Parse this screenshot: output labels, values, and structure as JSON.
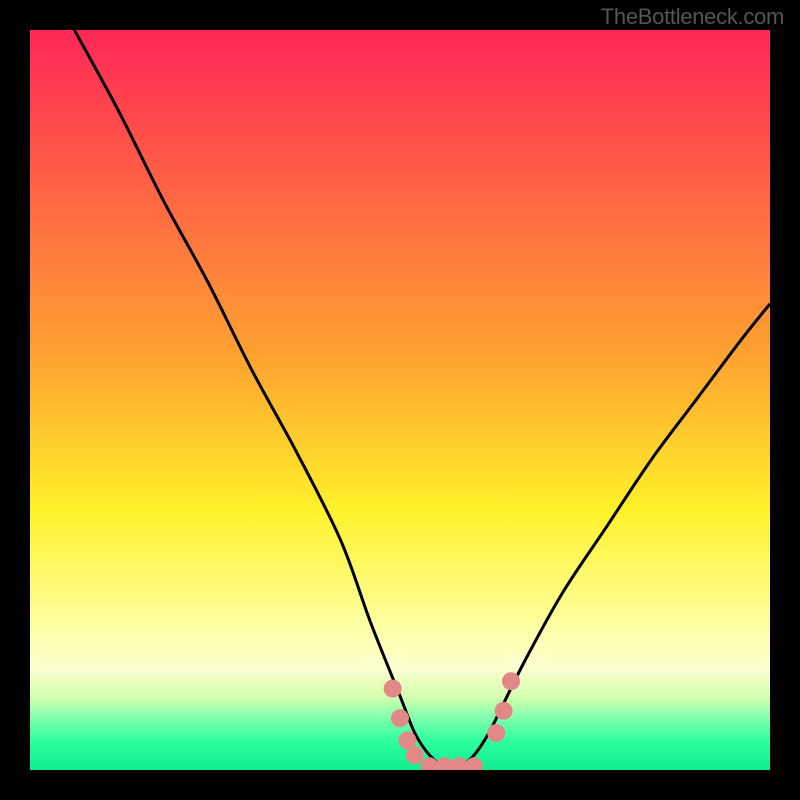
{
  "watermark": "TheBottleneck.com",
  "chart_data": {
    "type": "line",
    "title": "",
    "xlabel": "",
    "ylabel": "",
    "xlim": [
      0,
      100
    ],
    "ylim": [
      0,
      100
    ],
    "series": [
      {
        "name": "bottleneck-curve",
        "x": [
          6,
          12,
          18,
          24,
          30,
          36,
          42,
          46,
          50,
          52,
          54,
          56,
          58,
          60,
          62,
          64,
          67,
          72,
          78,
          84,
          90,
          96,
          100
        ],
        "y": [
          100,
          89,
          77,
          66,
          54,
          43,
          31,
          20,
          10,
          5,
          2,
          0.5,
          0.5,
          2,
          5,
          9,
          15,
          24,
          33,
          42,
          50,
          58,
          63
        ]
      }
    ],
    "markers": {
      "name": "highlight-dots",
      "color": "#e38888",
      "points": [
        {
          "x": 49,
          "y": 11
        },
        {
          "x": 50,
          "y": 7
        },
        {
          "x": 51,
          "y": 4
        },
        {
          "x": 52,
          "y": 2
        },
        {
          "x": 54,
          "y": 0.5
        },
        {
          "x": 56,
          "y": 0.5
        },
        {
          "x": 58,
          "y": 0.5
        },
        {
          "x": 60,
          "y": 0.5
        },
        {
          "x": 63,
          "y": 5
        },
        {
          "x": 64,
          "y": 8
        },
        {
          "x": 65,
          "y": 12
        }
      ]
    },
    "gradient_stops": [
      {
        "offset": 0.0,
        "color": "#ff2757"
      },
      {
        "offset": 0.45,
        "color": "#ffa530"
      },
      {
        "offset": 0.65,
        "color": "#fff22a"
      },
      {
        "offset": 0.8,
        "color": "#feff9e"
      },
      {
        "offset": 0.86,
        "color": "#fdffd0"
      },
      {
        "offset": 0.9,
        "color": "#d7ffb0"
      },
      {
        "offset": 0.93,
        "color": "#7fffad"
      },
      {
        "offset": 0.96,
        "color": "#2fff9f"
      },
      {
        "offset": 1.0,
        "color": "#10ee90"
      }
    ]
  }
}
